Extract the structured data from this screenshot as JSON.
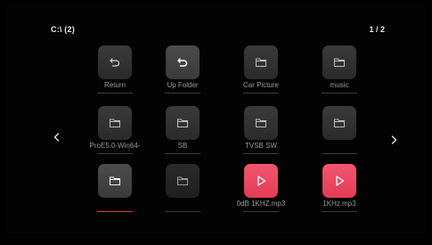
{
  "header": {
    "path": "C:\\ (2)",
    "page": "1 / 2"
  },
  "colors": {
    "background": "#030303",
    "tile": "#333333",
    "media_tile": "#e8455f",
    "label": "#9a9a9a",
    "selected_underline": "#e23a3a"
  },
  "navigation": {
    "prev_icon": "chevron-left-icon",
    "next_icon": "chevron-right-icon"
  },
  "items": [
    {
      "label": "Return",
      "icon": "return-icon",
      "type": "action"
    },
    {
      "label": "Up Folder",
      "icon": "return-icon",
      "type": "action"
    },
    {
      "label": "Car Picture",
      "icon": "folder-icon",
      "type": "folder"
    },
    {
      "label": "music",
      "icon": "folder-icon",
      "type": "folder"
    },
    {
      "label": "ProE5.0-Win64-",
      "icon": "folder-icon",
      "type": "folder"
    },
    {
      "label": "SB",
      "icon": "folder-icon",
      "type": "folder"
    },
    {
      "label": "TVSB SW",
      "icon": "folder-icon",
      "type": "folder"
    },
    {
      "label": "",
      "icon": "folder-icon",
      "type": "folder"
    },
    {
      "label": "",
      "icon": "folder-icon",
      "type": "folder",
      "selected": true
    },
    {
      "label": "",
      "icon": "folder-icon",
      "type": "folder"
    },
    {
      "label": "0dB 1KHZ.mp3",
      "icon": "play-icon",
      "type": "audio"
    },
    {
      "label": "1KHz.mp3",
      "icon": "play-icon",
      "type": "audio"
    }
  ]
}
